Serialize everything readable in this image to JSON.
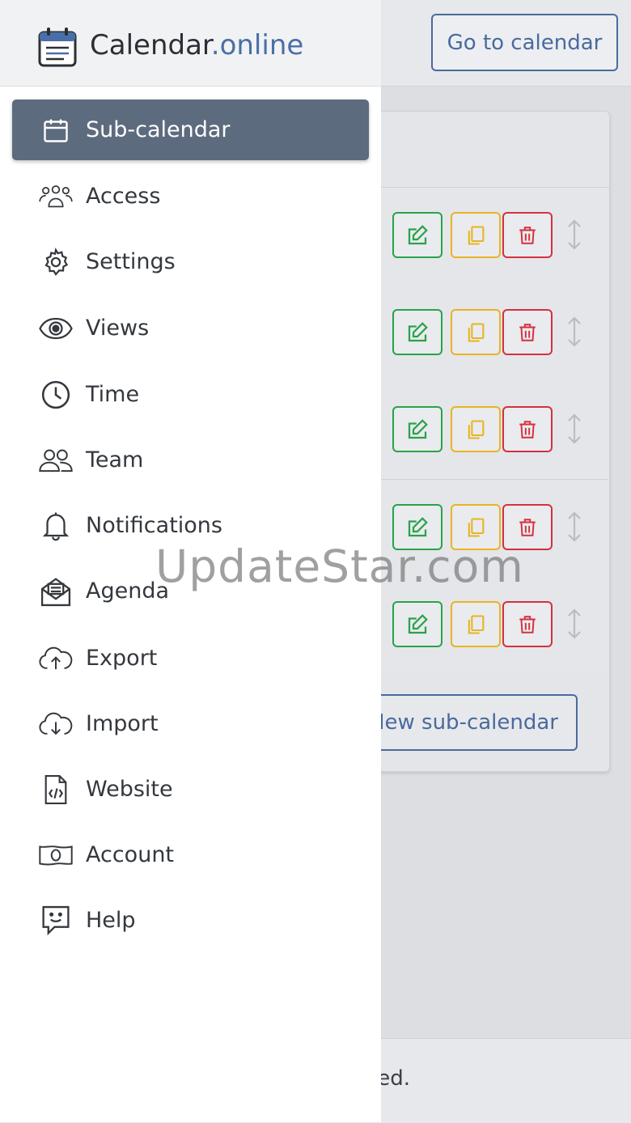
{
  "header": {
    "goto_label": "Go to calendar"
  },
  "brand": {
    "name": "Calendar",
    "accent": ".online"
  },
  "nav": {
    "items": [
      {
        "label": "Sub-calendar",
        "icon": "calendar-icon",
        "active": true
      },
      {
        "label": "Access",
        "icon": "users-icon"
      },
      {
        "label": "Settings",
        "icon": "gear-icon"
      },
      {
        "label": "Views",
        "icon": "eye-icon"
      },
      {
        "label": "Time",
        "icon": "clock-icon"
      },
      {
        "label": "Team",
        "icon": "team-icon"
      },
      {
        "label": "Notifications",
        "icon": "bell-icon"
      },
      {
        "label": "Agenda",
        "icon": "envelope-icon"
      },
      {
        "label": "Export",
        "icon": "cloud-upload-icon"
      },
      {
        "label": "Import",
        "icon": "cloud-download-icon"
      },
      {
        "label": "Website",
        "icon": "code-file-icon"
      },
      {
        "label": "Account",
        "icon": "money-icon"
      },
      {
        "label": "Help",
        "icon": "chat-smile-icon"
      }
    ]
  },
  "subcalendars": {
    "new_label": "New sub-calendar"
  },
  "footer": {
    "text": "ed."
  },
  "watermark": "UpdateStar.com",
  "colors": {
    "active_bg": "#5d6b7f",
    "brand_accent": "#4a6fa8",
    "edit": "#2aa24a",
    "copy": "#e8b423",
    "delete": "#d6303d"
  }
}
